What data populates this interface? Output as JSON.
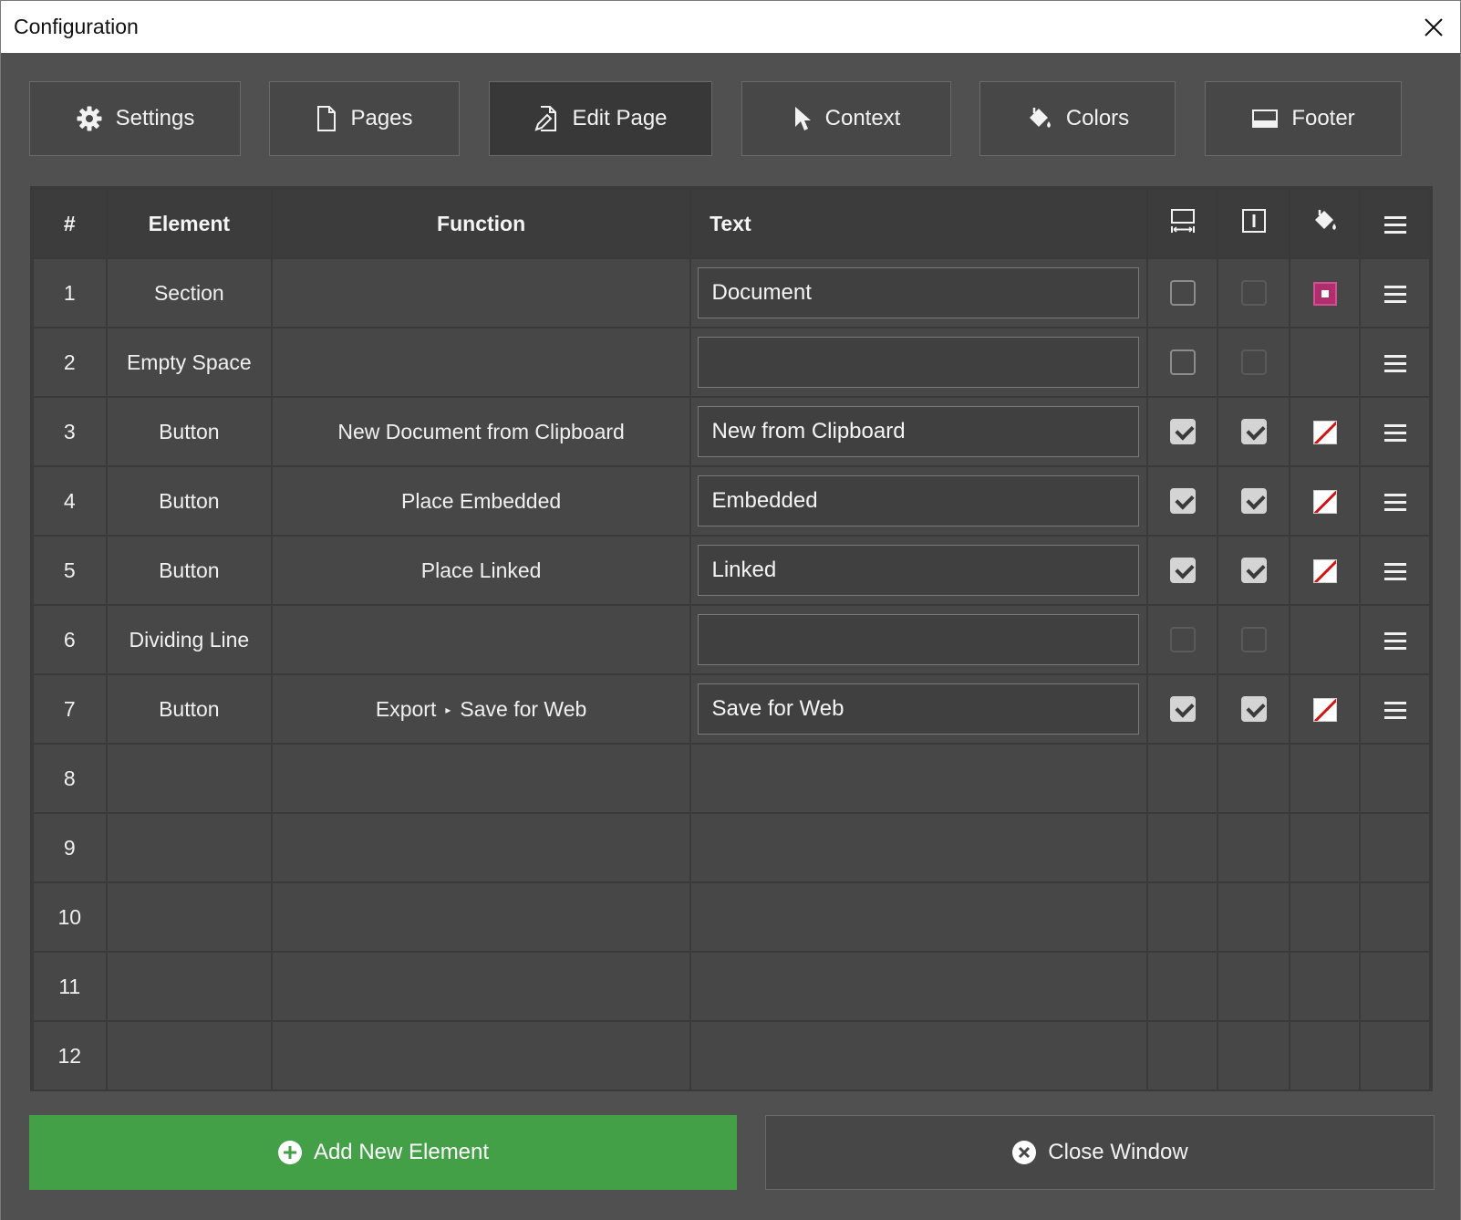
{
  "window": {
    "title": "Configuration"
  },
  "tabs": [
    {
      "label": "Settings",
      "icon": "gear-icon",
      "active": false
    },
    {
      "label": "Pages",
      "icon": "page-icon",
      "active": false
    },
    {
      "label": "Edit Page",
      "icon": "edit-page-icon",
      "active": true
    },
    {
      "label": "Context",
      "icon": "cursor-icon",
      "active": false
    },
    {
      "label": "Colors",
      "icon": "paint-bucket-icon",
      "active": false
    },
    {
      "label": "Footer",
      "icon": "footer-icon",
      "active": false
    }
  ],
  "table": {
    "headers": {
      "num": "#",
      "element": "Element",
      "function": "Function",
      "text": "Text",
      "full_width_icon": "full-width-icon",
      "text_field_icon": "text-field-icon",
      "color_icon": "paint-bucket-icon",
      "menu_icon": "menu-icon"
    },
    "rows": [
      {
        "num": "1",
        "element": "Section",
        "function": "",
        "text": "Document",
        "col1": "unchecked",
        "col2": "disabled",
        "color": "magenta",
        "menu": true
      },
      {
        "num": "2",
        "element": "Empty Space",
        "function": "",
        "text": "",
        "col1": "unchecked",
        "col2": "disabled",
        "color": "",
        "menu": true
      },
      {
        "num": "3",
        "element": "Button",
        "function": "New Document from Clipboard",
        "text": "New from Clipboard",
        "col1": "checked",
        "col2": "checked",
        "color": "none",
        "menu": true
      },
      {
        "num": "4",
        "element": "Button",
        "function": "Place Embedded",
        "text": "Embedded",
        "col1": "checked",
        "col2": "checked",
        "color": "none",
        "menu": true
      },
      {
        "num": "5",
        "element": "Button",
        "function": "Place Linked",
        "text": "Linked",
        "col1": "checked",
        "col2": "checked",
        "color": "none",
        "menu": true
      },
      {
        "num": "6",
        "element": "Dividing Line",
        "function": "",
        "text": "",
        "col1": "disabled",
        "col2": "disabled",
        "color": "",
        "menu": true
      },
      {
        "num": "7",
        "element": "Button",
        "function_parts": [
          "Export",
          "Save for Web"
        ],
        "function_separator": "▸",
        "text": "Save for Web",
        "col1": "checked",
        "col2": "checked",
        "color": "none",
        "menu": true
      },
      {
        "num": "8"
      },
      {
        "num": "9"
      },
      {
        "num": "10"
      },
      {
        "num": "11"
      },
      {
        "num": "12"
      }
    ]
  },
  "footer": {
    "add_label": "Add New Element",
    "add_icon": "plus-circle-icon",
    "add_color": "#43a047",
    "close_label": "Close Window",
    "close_icon": "x-circle-icon"
  },
  "colors": {
    "magenta_swatch": "#b02d6e",
    "none_swatch_slash": "#d01515"
  }
}
